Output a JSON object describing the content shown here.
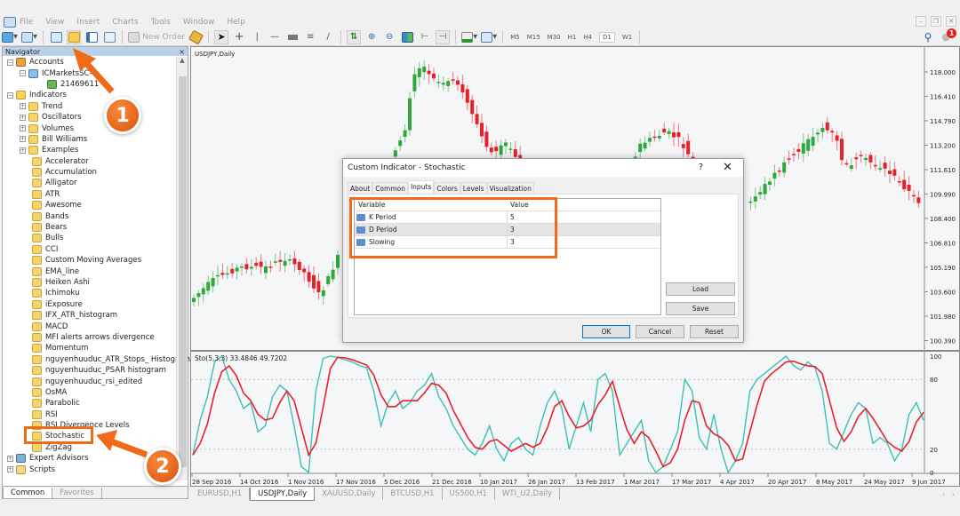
{
  "menu": [
    "File",
    "View",
    "Insert",
    "Charts",
    "Tools",
    "Window",
    "Help"
  ],
  "toolbar": {
    "new_order_label": "New Order",
    "timeframes": [
      "M5",
      "M15",
      "M30",
      "H1",
      "H4",
      "D1",
      "W1"
    ],
    "active_timeframe": "D1",
    "notification_count": "1"
  },
  "navigator": {
    "title": "Navigator",
    "accounts_label": "Accounts",
    "server_label": "ICMarketsSC-",
    "account_number": "21469611",
    "indicators_label": "Indicators",
    "folders": [
      "Trend",
      "Oscillators",
      "Volumes",
      "Bill Williams",
      "Examples"
    ],
    "indicators": [
      "Accelerator",
      "Accumulation",
      "Alligator",
      "ATR",
      "Awesome",
      "Bands",
      "Bears",
      "Bulls",
      "CCI",
      "Custom Moving Averages",
      "EMA_line",
      "Heiken Ashi",
      "Ichimoku",
      "iExposure",
      "IFX_ATR_histogram",
      "MACD",
      "MFI alerts arrows divergence",
      "Momentum",
      "nguyenhuuduc_ATR_Stops_ Histogram",
      "nguyenhuuduc_PSAR histogram",
      "nguyenhuuduc_rsi_edited",
      "OsMA",
      "Parabolic",
      "RSI",
      "RSI Divergence Levels",
      "Stochastic",
      "ZigZag"
    ],
    "selected_indicator": "Stochastic",
    "expert_advisors_label": "Expert Advisors",
    "scripts_label": "Scripts",
    "tabs": [
      "Common",
      "Favorites"
    ],
    "active_tab": "Common"
  },
  "chart": {
    "symbol_label": "USDJPY,Daily",
    "price_axis": [
      "118.000",
      "116.410",
      "114.790",
      "113.200",
      "111.610",
      "109.990",
      "108.400",
      "106.810",
      "105.190",
      "103.600",
      "101.980",
      "100.390"
    ],
    "current_price": "109.990",
    "indicator_label": "Sto(5,3,3) 33.4846 49.7202",
    "indicator_axis": [
      "100",
      "80",
      "20",
      "0"
    ],
    "date_axis": [
      "28 Sep 2016",
      "14 Oct 2016",
      "1 Nov 2016",
      "17 Nov 2016",
      "5 Dec 2016",
      "21 Dec 2016",
      "10 Jan 2017",
      "26 Jan 2017",
      "13 Feb 2017",
      "1 Mar 2017",
      "17 Mar 2017",
      "4 Apr 2017",
      "20 Apr 2017",
      "8 May 2017",
      "24 May 2017",
      "9 Jun 2017"
    ],
    "bull_color": "#2ea83a",
    "bear_color": "#e8202a",
    "main_line_color": "#3cbfb5",
    "signal_line_color": "#e8202a"
  },
  "chart_tabs": [
    "EURUSD,H1",
    "USDJPY,Daily",
    "XAUUSD,Daily",
    "BTCUSD,H1",
    "US500,H1",
    "WTI_U2,Daily"
  ],
  "active_chart_tab": "USDJPY,Daily",
  "dialog": {
    "title": "Custom Indicator - Stochastic",
    "help_label": "?",
    "close_label": "✕",
    "tabs": [
      "About",
      "Common",
      "Inputs",
      "Colors",
      "Levels",
      "Visualization"
    ],
    "active_tab": "Inputs",
    "columns": [
      "Variable",
      "Value"
    ],
    "rows": [
      {
        "variable": "K Period",
        "value": "5"
      },
      {
        "variable": "D Period",
        "value": "3"
      },
      {
        "variable": "Slowing",
        "value": "3"
      }
    ],
    "load_label": "Load",
    "save_label": "Save",
    "ok_label": "OK",
    "cancel_label": "Cancel",
    "reset_label": "Reset"
  },
  "annotations": {
    "step1": "1",
    "step2": "2",
    "accent": "#f06a17"
  }
}
